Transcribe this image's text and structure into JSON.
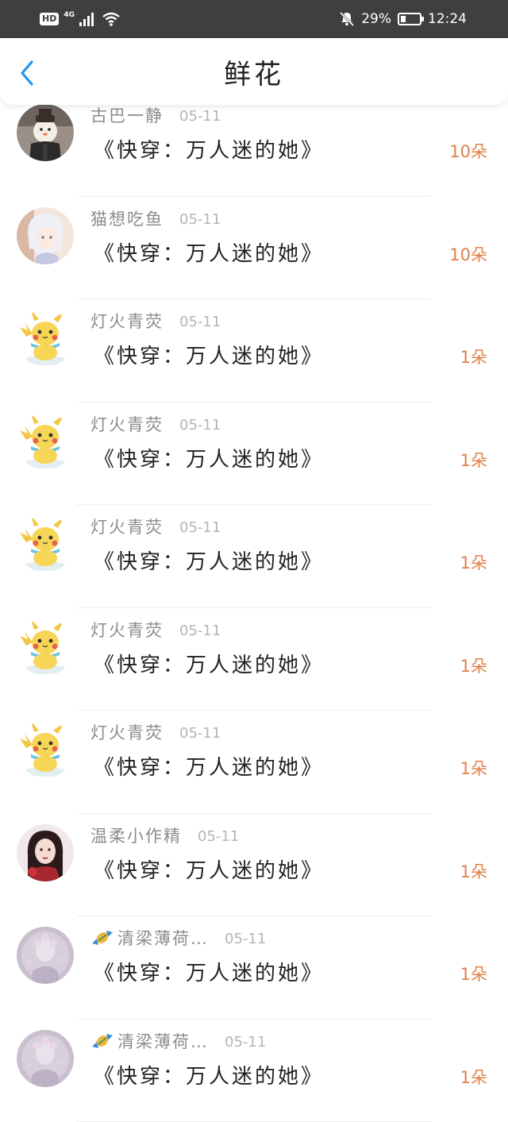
{
  "status_bar": {
    "hd": "HD",
    "network": "4G",
    "battery_percent": "29%",
    "battery_level": 0.29,
    "time": "12:24"
  },
  "header": {
    "title": "鲜花",
    "back_icon": "chevron-left-icon"
  },
  "colors": {
    "accent": "#2196f3",
    "count": "#e0804a",
    "username": "#8c8c8c"
  },
  "entries": [
    {
      "username": "古巴一静",
      "date": "05-11",
      "book": "《快穿：万人迷的她》",
      "count": "10朵",
      "avatar": "snowman-avatar"
    },
    {
      "username": "猫想吃鱼",
      "date": "05-11",
      "book": "《快穿：万人迷的她》",
      "count": "10朵",
      "avatar": "anime-girl-avatar"
    },
    {
      "username": "灯火青荧",
      "date": "05-11",
      "book": "《快穿：万人迷的她》",
      "count": "1朵",
      "avatar": "pikachu-avatar"
    },
    {
      "username": "灯火青荧",
      "date": "05-11",
      "book": "《快穿：万人迷的她》",
      "count": "1朵",
      "avatar": "pikachu-avatar"
    },
    {
      "username": "灯火青荧",
      "date": "05-11",
      "book": "《快穿：万人迷的她》",
      "count": "1朵",
      "avatar": "pikachu-avatar"
    },
    {
      "username": "灯火青荧",
      "date": "05-11",
      "book": "《快穿：万人迷的她》",
      "count": "1朵",
      "avatar": "pikachu-avatar"
    },
    {
      "username": "灯火青荧",
      "date": "05-11",
      "book": "《快穿：万人迷的她》",
      "count": "1朵",
      "avatar": "pikachu-avatar"
    },
    {
      "username": "温柔小作精",
      "date": "05-11",
      "book": "《快穿：万人迷的她》",
      "count": "1朵",
      "avatar": "girl-portrait-avatar"
    },
    {
      "username": "清梁薄荷…",
      "date": "05-11",
      "book": "《快穿：万人迷的她》",
      "count": "1朵",
      "avatar": "purple-flower-avatar",
      "prefix_icon": "candy-icon"
    },
    {
      "username": "清梁薄荷…",
      "date": "05-11",
      "book": "《快穿：万人迷的她》",
      "count": "1朵",
      "avatar": "purple-flower-avatar",
      "prefix_icon": "candy-icon"
    }
  ]
}
